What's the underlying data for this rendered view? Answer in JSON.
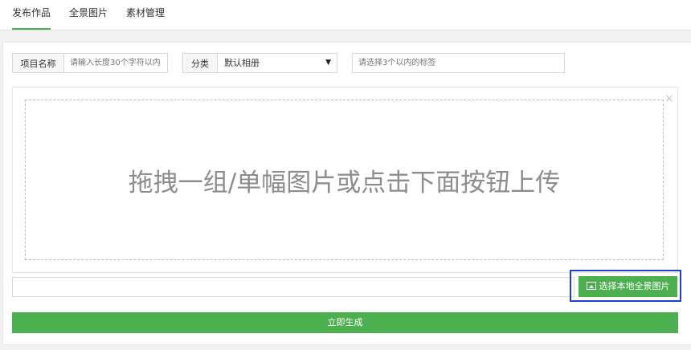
{
  "tabs": [
    {
      "label": "发布作品"
    },
    {
      "label": "全景图片"
    },
    {
      "label": "素材管理"
    }
  ],
  "form": {
    "name_label": "项目名称",
    "name_placeholder": "请输入长度30个字符以内",
    "category_label": "分类",
    "category_value": "默认相册",
    "tags_placeholder": "请选择3个以内的标签"
  },
  "upload": {
    "drop_text": "拖拽一组/单幅图片或点击下面按钮上传",
    "close_symbol": "×",
    "choose_label": "选择本地全景图片",
    "file_path_value": ""
  },
  "submit_label": "立即生成",
  "colors": {
    "accent": "#4caf50",
    "highlight": "#1e3fd0"
  }
}
